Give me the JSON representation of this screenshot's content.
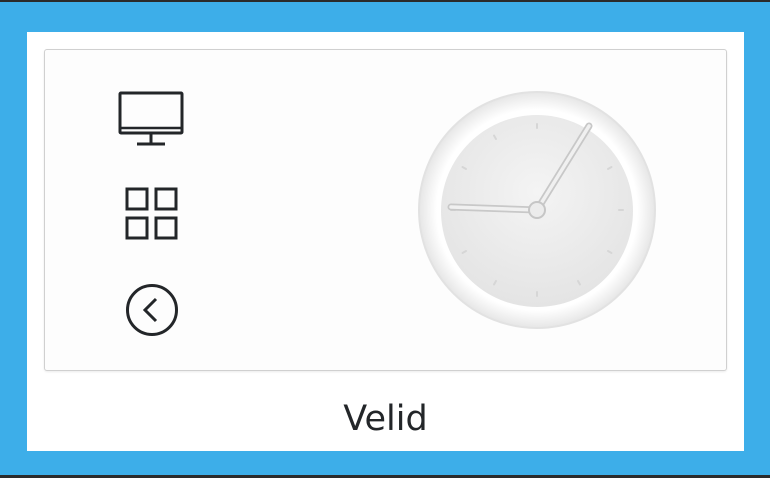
{
  "theme": {
    "selection_color": "#3daee9",
    "card_background": "#ffffff",
    "text_color": "#232629"
  },
  "preview": {
    "icons": [
      "monitor-icon",
      "grid-icon",
      "back-arrow-circle-icon"
    ],
    "clock_icon": "analog-clock-icon"
  },
  "item": {
    "label": "Velid"
  }
}
